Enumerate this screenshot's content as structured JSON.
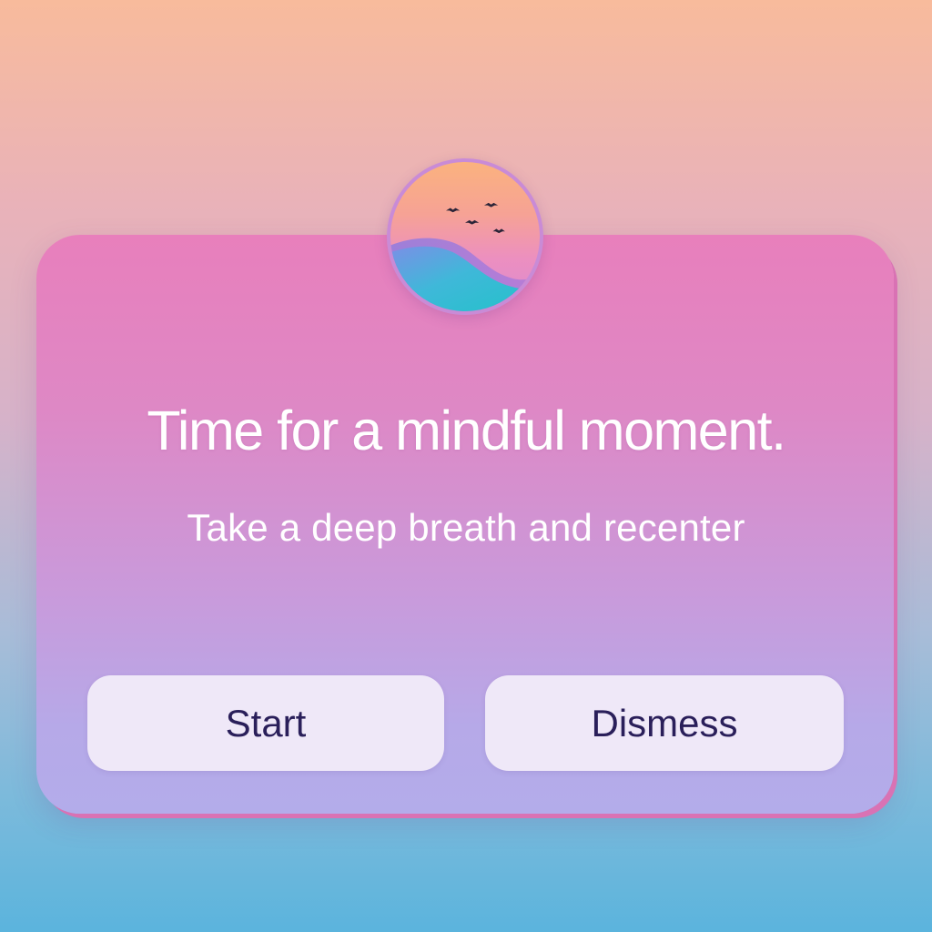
{
  "dialog": {
    "title": "Time for a mindful moment.",
    "subtitle": "Take a deep breath and recenter",
    "start_label": "Start",
    "dismiss_label": "Dismess"
  },
  "badge": {
    "icon": "sunset-birds-waves-icon"
  },
  "colors": {
    "background_top": "#f8bb9c",
    "background_bottom": "#5bb4dd",
    "card_top": "#e87fbc",
    "card_bottom": "#b3acea",
    "button_background": "#efe8f8",
    "button_text": "#2a1f5a",
    "text": "#ffffff"
  }
}
